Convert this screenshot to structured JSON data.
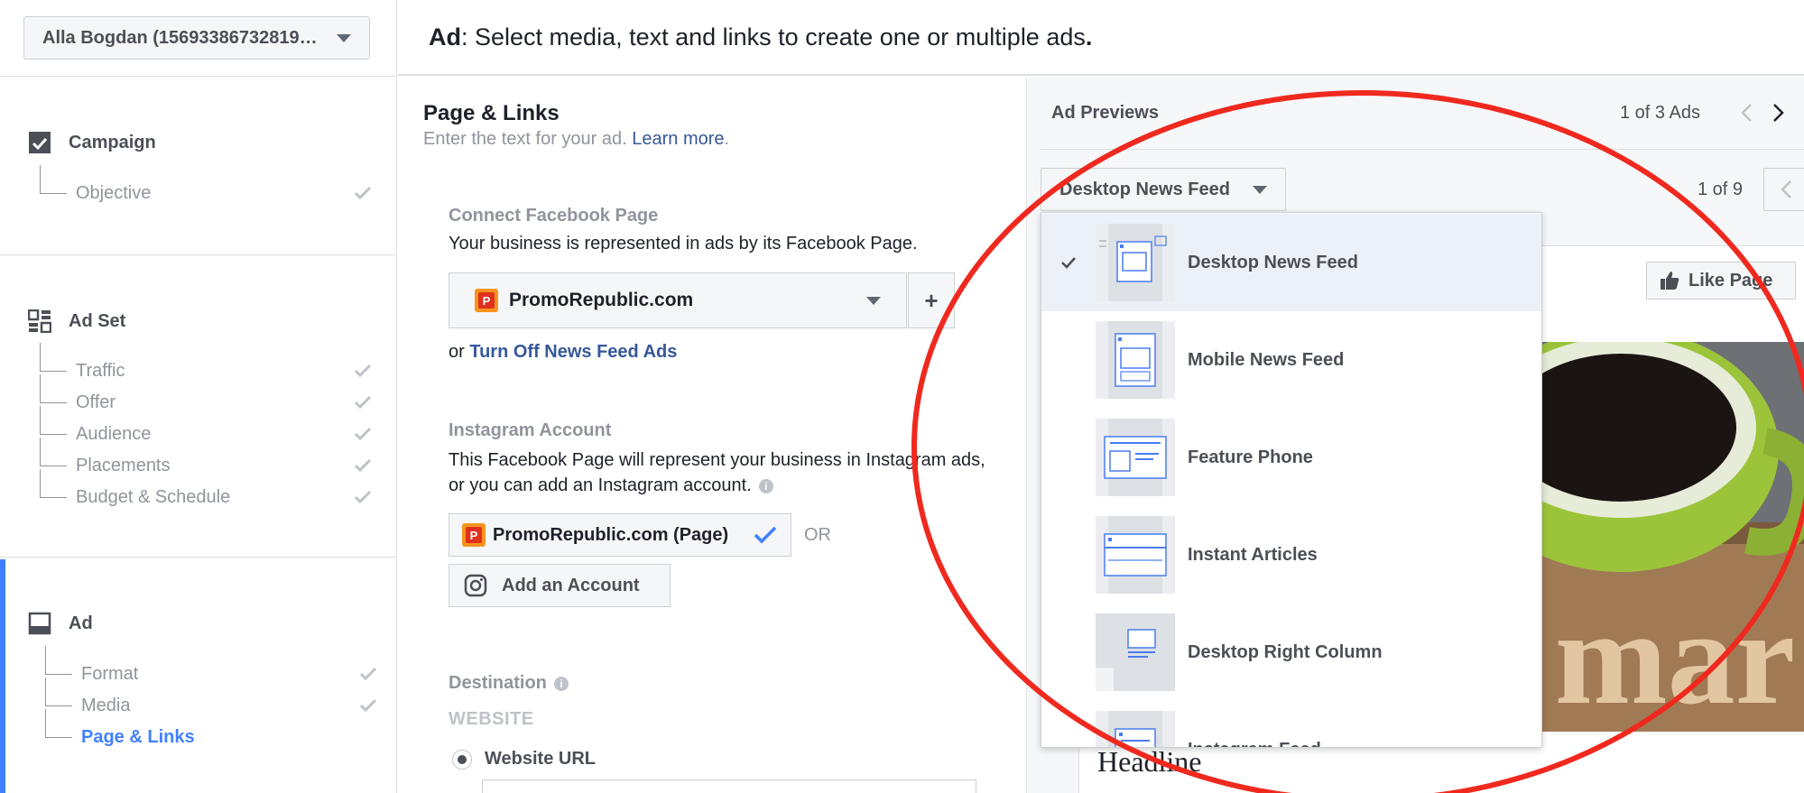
{
  "sidebar": {
    "account": "Alla Bogdan (15693386732819…",
    "sections": [
      {
        "title": "Campaign",
        "items": [
          {
            "label": "Objective"
          }
        ]
      },
      {
        "title": "Ad Set",
        "items": [
          {
            "label": "Traffic"
          },
          {
            "label": "Offer"
          },
          {
            "label": "Audience"
          },
          {
            "label": "Placements"
          },
          {
            "label": "Budget & Schedule"
          }
        ]
      },
      {
        "title": "Ad",
        "items": [
          {
            "label": "Format"
          },
          {
            "label": "Media"
          },
          {
            "label": "Page & Links"
          }
        ]
      }
    ]
  },
  "header": {
    "bold": "Ad",
    "text": ": Select media, text and links to create one or multiple ads",
    "end": "."
  },
  "page_links": {
    "title": "Page & Links",
    "subtitle": "Enter the text for your ad. ",
    "learn_more": "Learn more",
    "subtitle_end": ".",
    "connect_label": "Connect Facebook Page",
    "connect_desc": "Your business is represented in ads by its Facebook Page.",
    "page_value": "PromoRepublic.com",
    "logo_letter": "P",
    "plus": "+",
    "or_prefix": "or ",
    "turn_off_link": "Turn Off News Feed Ads",
    "instagram_label": "Instagram Account",
    "instagram_desc": "This Facebook Page will represent your business in Instagram ads, or you can add an Instagram account.",
    "instagram_page": "PromoRepublic.com (Page)",
    "or_label": "OR",
    "add_account": "Add an Account",
    "destination_label": "Destination",
    "website_caps": "WEBSITE",
    "website_url_label": "Website URL"
  },
  "preview": {
    "title": "Ad Previews",
    "ads_count": "1 of 3 Ads",
    "placement_selected": "Desktop News Feed",
    "placement_count": "1 of 9",
    "like_page": "Like Page",
    "headline": "Headline",
    "image_text": "mar"
  },
  "dropdown": {
    "items": [
      {
        "label": "Desktop News Feed",
        "selected": true
      },
      {
        "label": "Mobile News Feed"
      },
      {
        "label": "Feature Phone"
      },
      {
        "label": "Instant Articles"
      },
      {
        "label": "Desktop Right Column"
      },
      {
        "label": "Instagram Feed"
      }
    ]
  },
  "colors": {
    "accent": "#4080ff",
    "link": "#365899",
    "annotation": "#f0291f",
    "muted": "#90949c"
  }
}
